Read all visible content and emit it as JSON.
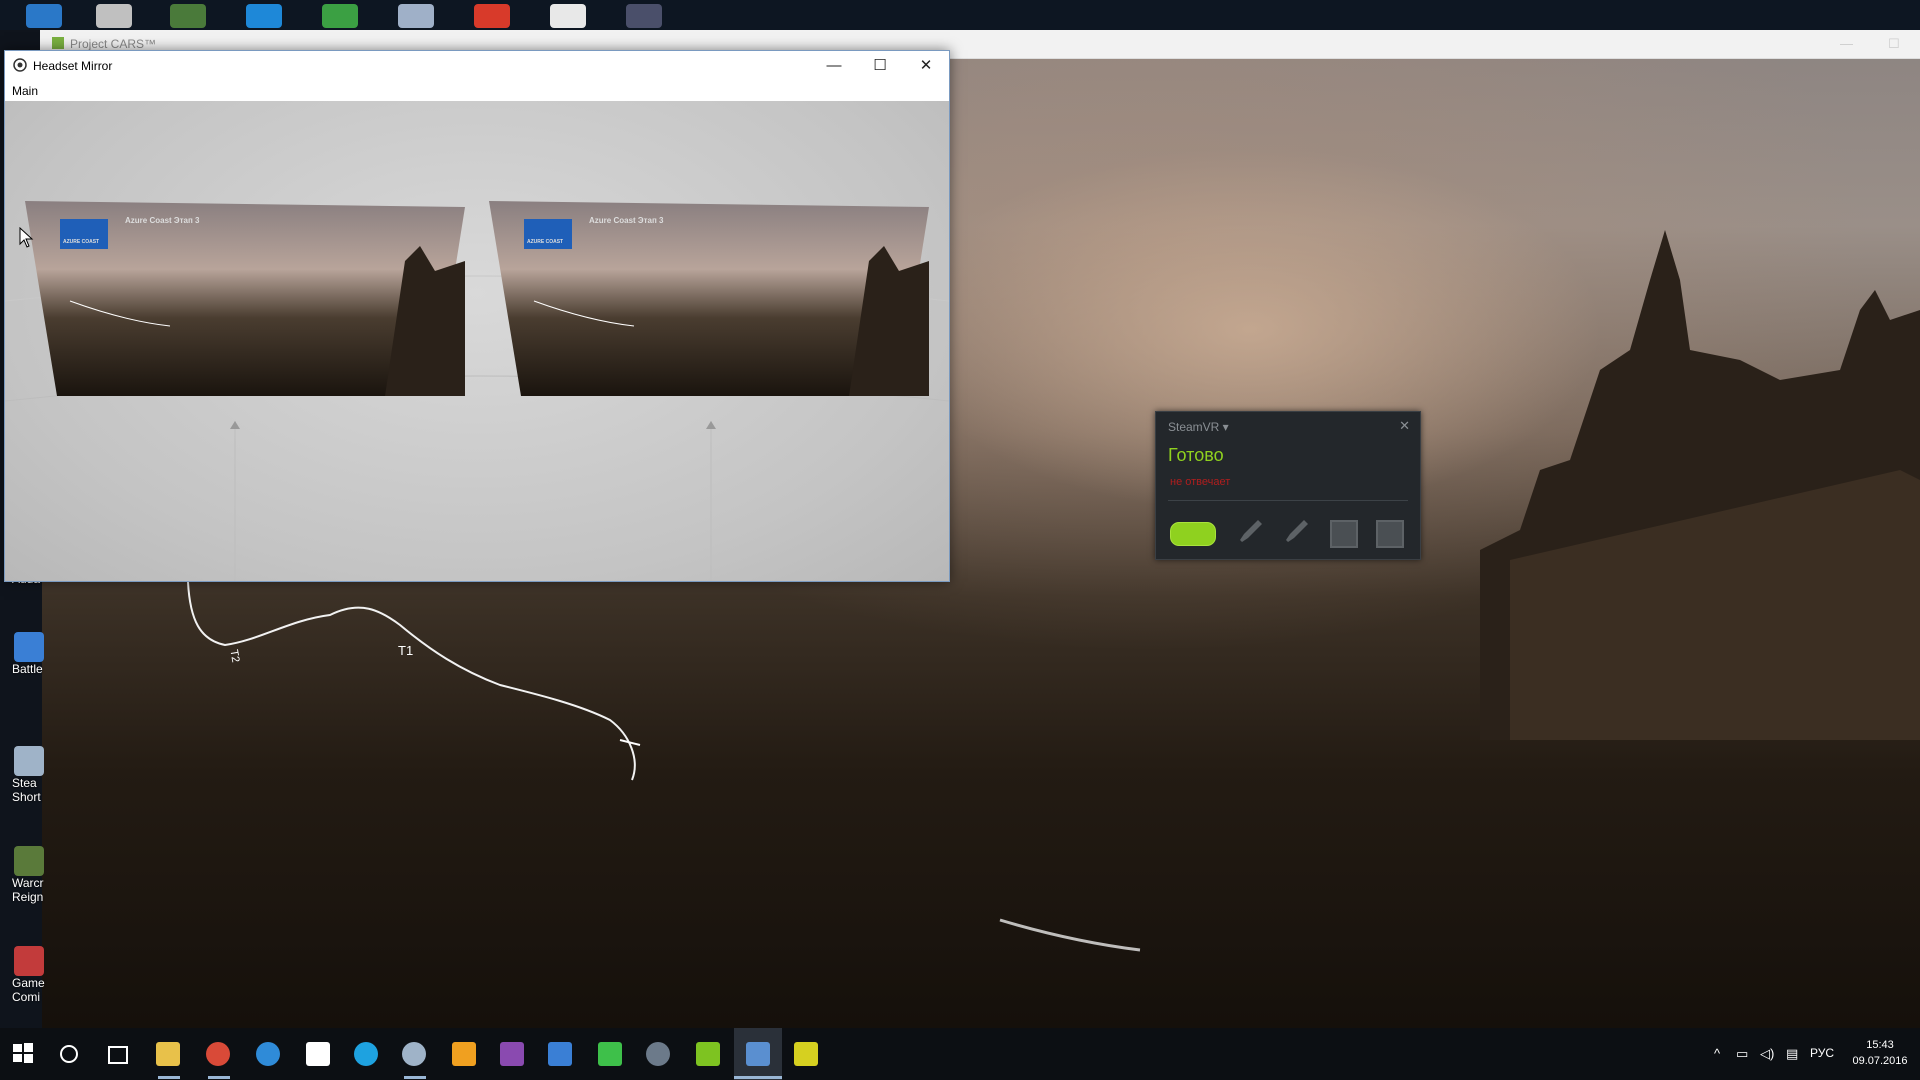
{
  "game_window": {
    "title": "Project CARS™"
  },
  "headset_mirror": {
    "title": "Headset Mirror",
    "menu": [
      "Main"
    ],
    "eye_panel_title": "Azure Coast Этап 3",
    "eye_panel_badge": "AZURE COAST"
  },
  "track_labels": [
    "T1",
    "T2"
  ],
  "desktop_icons": [
    {
      "label": "Auda",
      "color": "#c9a23b"
    },
    {
      "label": "Battle",
      "color": "#3a7fd5"
    },
    {
      "label": "Stea\nShort",
      "color": "#9fb3c8"
    },
    {
      "label": "Warcr\nReign",
      "color": "#5a7a3a"
    },
    {
      "label": "Game\nComi",
      "color": "#c23b3b"
    }
  ],
  "top_icons_colors": [
    "#2a78c8",
    "#c0c0c0",
    "#4a7a3a",
    "#1e88d8",
    "#3ba043",
    "#9fb0c8",
    "#d83a2a",
    "#e8e8e8",
    "#4a4f6a"
  ],
  "steamvr": {
    "title": "SteamVR ▾",
    "status": "Готово",
    "substatus": "не отвечает",
    "accent_color": "#8fd11f"
  },
  "taskbar": {
    "apps": [
      {
        "name": "search-icon",
        "color": "#ffffff"
      },
      {
        "name": "task-view-icon",
        "color": "#ffffff"
      },
      {
        "name": "file-explorer-icon",
        "color": "#e8c14a"
      },
      {
        "name": "chrome-icon",
        "color": "#d94a38"
      },
      {
        "name": "edge-icon",
        "color": "#2f8bd8"
      },
      {
        "name": "store-icon",
        "color": "#ffffff"
      },
      {
        "name": "skype-icon",
        "color": "#1ea2e0"
      },
      {
        "name": "steam-icon",
        "color": "#9fb3c8"
      },
      {
        "name": "vlc-icon",
        "color": "#f0a020"
      },
      {
        "name": "winrar-icon",
        "color": "#8a4ab0"
      },
      {
        "name": "app-blue-icon",
        "color": "#3a7fd5"
      },
      {
        "name": "razer-icon",
        "color": "#3ec04a"
      },
      {
        "name": "steamvr-icon",
        "color": "#6c7a8a"
      },
      {
        "name": "nvidia-icon",
        "color": "#7ec321"
      },
      {
        "name": "settings-icon",
        "color": "#5a8fd0"
      },
      {
        "name": "project-cars-icon",
        "color": "#d6d020"
      }
    ],
    "language": "РУС",
    "time": "15:43",
    "date": "09.07.2016"
  }
}
